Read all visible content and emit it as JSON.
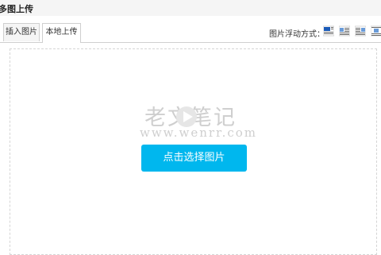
{
  "window": {
    "title": "多图上传"
  },
  "tabs": [
    {
      "label": "插入图片"
    },
    {
      "label": "本地上传",
      "active": true
    }
  ],
  "alignment": {
    "label": "图片浮动方式：",
    "options": [
      "none-icon",
      "left-icon",
      "right-icon",
      "center-icon"
    ],
    "selected_index": 0
  },
  "upload": {
    "button_label": "点击选择图片"
  },
  "watermark": {
    "text": "老文笔记",
    "url": "www.wenrr.com"
  },
  "colors": {
    "accent": "#00b7ee",
    "tab_border": "#cfcfcf",
    "dashed_border": "#d5d5d5",
    "icon_selected": "#1a5bb8"
  }
}
